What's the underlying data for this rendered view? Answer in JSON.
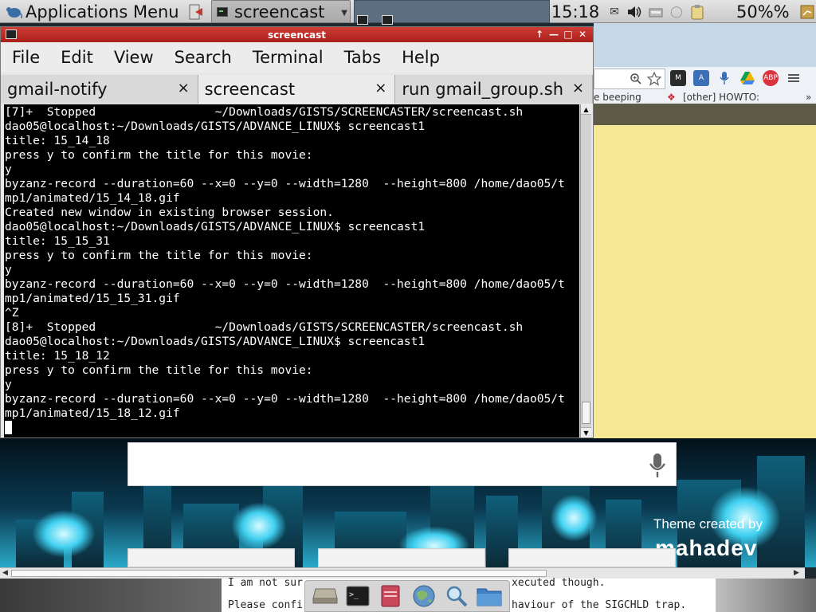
{
  "panel": {
    "app_menu_label": "Applications Menu",
    "task_button_label": "screencast",
    "clock": "15:18",
    "battery": "50%%"
  },
  "terminal": {
    "title": "screencast",
    "menus": [
      "File",
      "Edit",
      "View",
      "Search",
      "Terminal",
      "Tabs",
      "Help"
    ],
    "tabs": [
      {
        "label": "gmail-notify",
        "active": false
      },
      {
        "label": "screencast",
        "active": true
      },
      {
        "label": "run gmail_group.sh",
        "active": false
      }
    ],
    "lines": [
      "[7]+  Stopped                 ~/Downloads/GISTS/SCREENCASTER/screencast.sh",
      "dao05@localhost:~/Downloads/GISTS/ADVANCE_LINUX$ screencast1",
      "title: 15_14_18",
      "press y to confirm the title for this movie:",
      "y",
      "byzanz-record --duration=60 --x=0 --y=0 --width=1280  --height=800 /home/dao05/t",
      "mp1/animated/15_14_18.gif",
      "Created new window in existing browser session.",
      "dao05@localhost:~/Downloads/GISTS/ADVANCE_LINUX$ screencast1",
      "title: 15_15_31",
      "press y to confirm the title for this movie:",
      "y",
      "byzanz-record --duration=60 --x=0 --y=0 --width=1280  --height=800 /home/dao05/t",
      "mp1/animated/15_15_31.gif",
      "^Z",
      "[8]+  Stopped                 ~/Downloads/GISTS/SCREENCASTER/screencast.sh",
      "dao05@localhost:~/Downloads/GISTS/ADVANCE_LINUX$ screencast1",
      "title: 15_18_12",
      "press y to confirm the title for this movie:",
      "y",
      "byzanz-record --duration=60 --x=0 --y=0 --width=1280  --height=800 /home/dao05/t",
      "mp1/animated/15_18_12.gif"
    ]
  },
  "browser": {
    "bookmark_1": "e beeping",
    "bookmark_2": "[other] HOWTO:",
    "ext_gmail": "M",
    "ext_abp": "ABP"
  },
  "newtab": {
    "theme_credit": "Theme created by",
    "theme_author": "mahadev"
  },
  "document": {
    "line1_left": "I am not sur",
    "line1_right": "xecuted though.",
    "line2_left": "Please confi",
    "line2_right": "haviour of the SIGCHLD trap."
  },
  "icons": {
    "mouse": "xfce-mouse-icon",
    "volume": "volume-icon",
    "mail": "mail-icon"
  }
}
